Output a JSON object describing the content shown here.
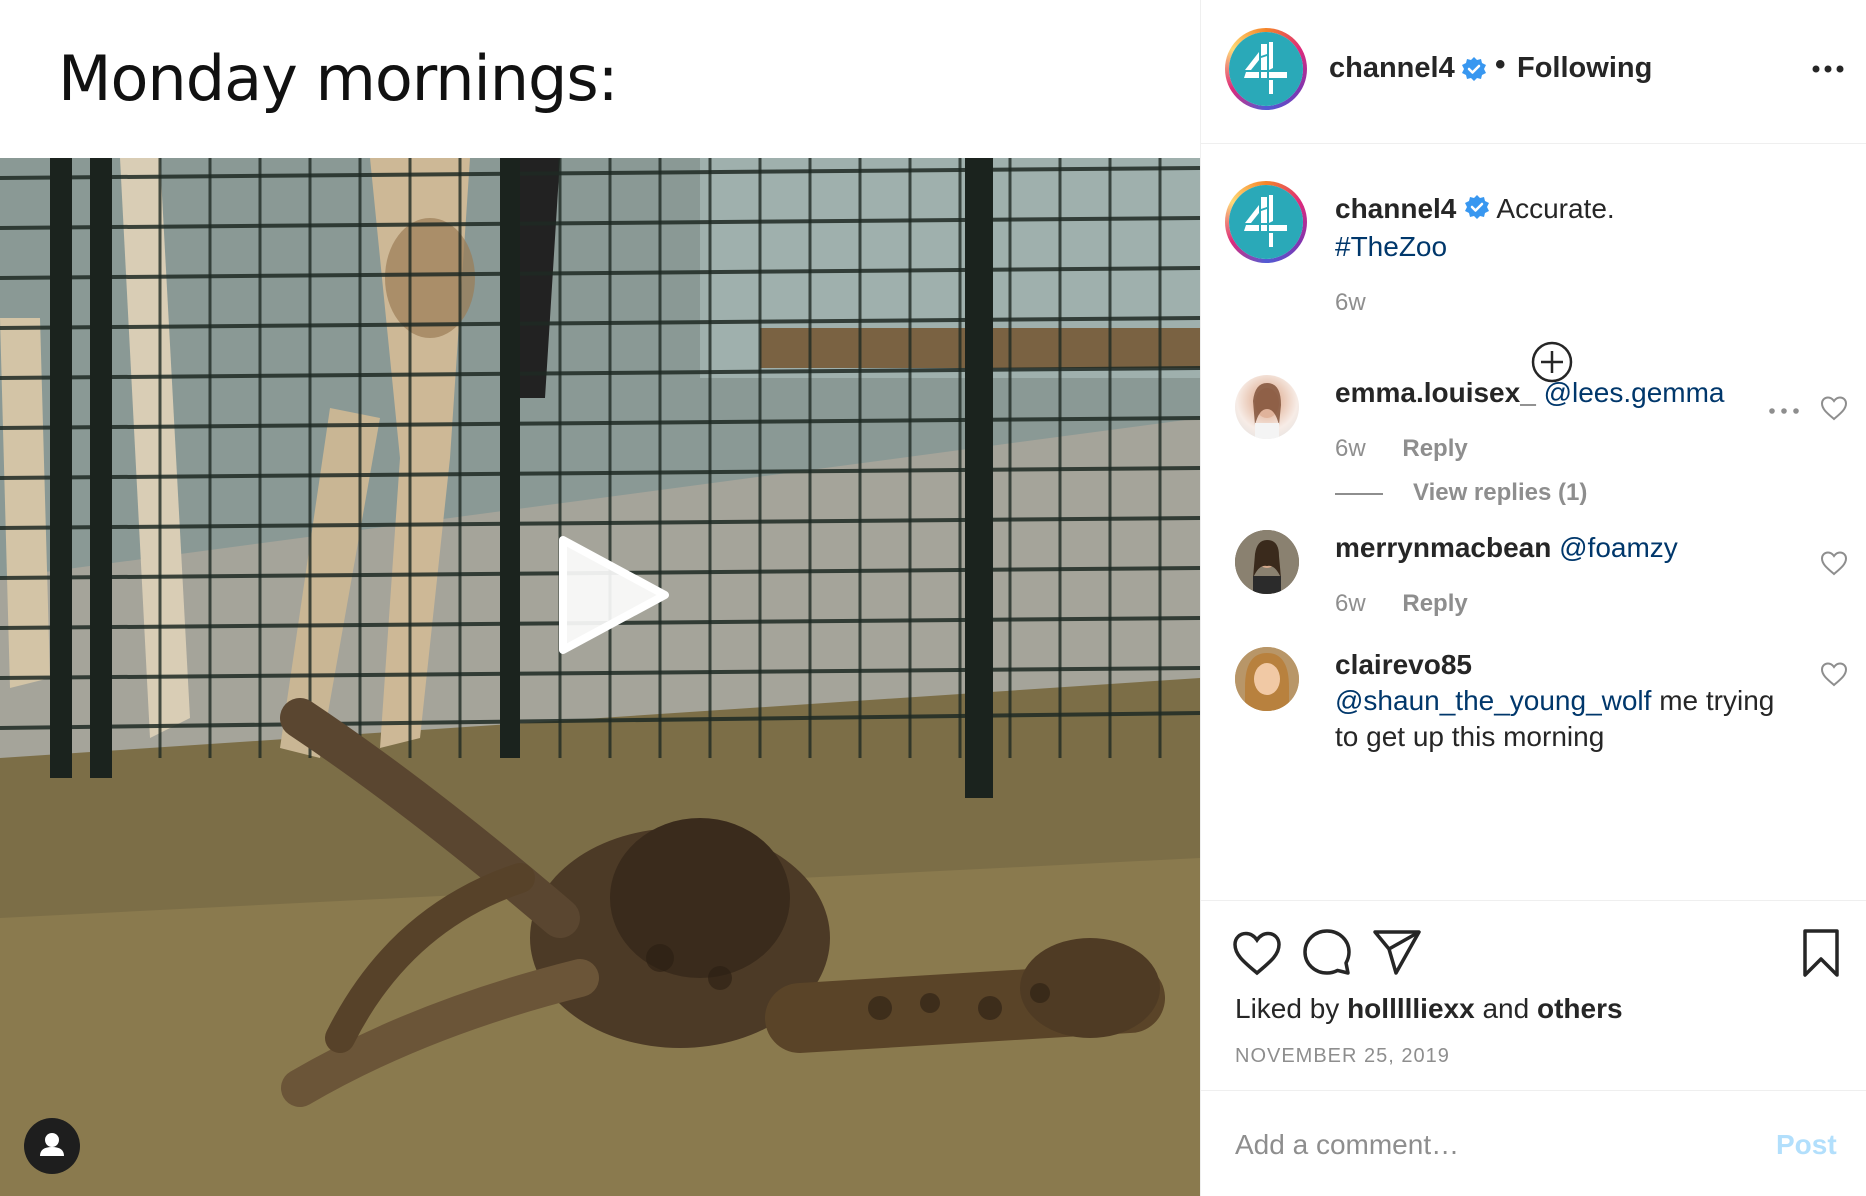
{
  "media": {
    "caption_overlay": "Monday mornings:"
  },
  "header": {
    "username": "channel4",
    "separator": "•",
    "follow_status": "Following"
  },
  "caption": {
    "username": "channel4",
    "text": "Accurate.",
    "hashtag": "#TheZoo",
    "time": "6w"
  },
  "comments": [
    {
      "username": "emma.louisex_",
      "mention": "@lees.gemma",
      "text": "",
      "time": "6w",
      "reply_label": "Reply",
      "view_replies": "View replies (1)"
    },
    {
      "username": "merrynmacbean",
      "mention": "@foamzy",
      "text": "",
      "time": "6w",
      "reply_label": "Reply"
    },
    {
      "username": "clairevo85",
      "mention": "@shaun_the_young_wolf",
      "text": "me trying to get up this morning"
    }
  ],
  "likes": {
    "prefix": "Liked by",
    "liked_by": "hollllliexx",
    "and": "and",
    "others": "others"
  },
  "date": "NOVEMBER 25, 2019",
  "add_comment": {
    "placeholder": "Add a comment…",
    "post_label": "Post"
  },
  "colors": {
    "link": "#00376b",
    "verified": "#3897f0",
    "brand_teal": "#2aa9b8",
    "post_disabled": "#b2dffc"
  },
  "icons": [
    "play-icon",
    "user-tag-icon",
    "verified-icon",
    "more-icon",
    "plus-circle-icon",
    "heart-icon",
    "comment-icon",
    "share-icon",
    "bookmark-icon"
  ]
}
